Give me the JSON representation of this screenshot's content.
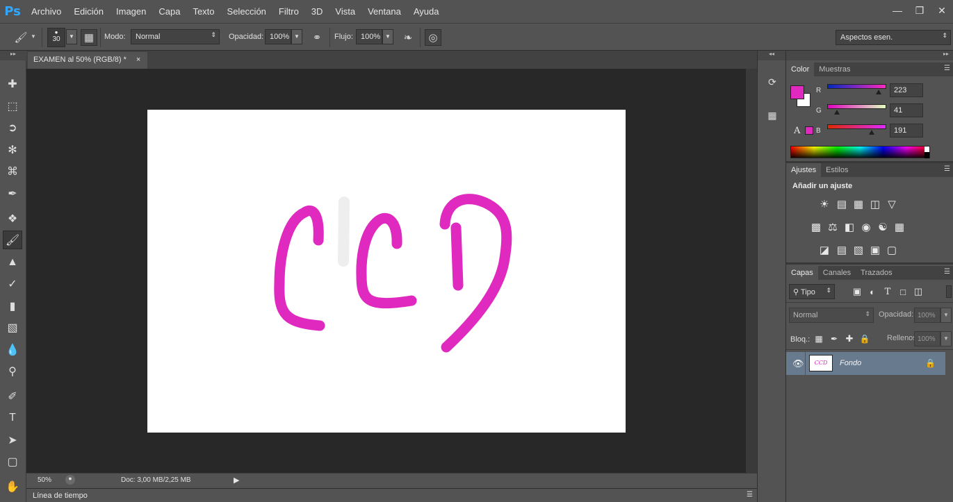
{
  "app": {
    "logo": "Ps"
  },
  "menu": [
    "Archivo",
    "Edición",
    "Imagen",
    "Capa",
    "Texto",
    "Selección",
    "Filtro",
    "3D",
    "Vista",
    "Ventana",
    "Ayuda"
  ],
  "window_controls": [
    "minimize-icon",
    "restore-icon",
    "close-icon"
  ],
  "options": {
    "brush_size": "30",
    "mode_label": "Modo:",
    "mode_value": "Normal",
    "opacity_label": "Opacidad:",
    "opacity_value": "100%",
    "flow_label": "Flujo:",
    "flow_value": "100%",
    "workspace": "Aspectos esen."
  },
  "document": {
    "tab_title": "EXAMEN al 50% (RGB/8) *",
    "tab_close": "×",
    "canvas_text": "CCD",
    "brush_color": "#df29bf"
  },
  "status": {
    "zoom": "50%",
    "doc_info": "Doc: 3,00 MB/2,25 MB"
  },
  "timeline": {
    "label": "Línea de tiempo"
  },
  "color_panel": {
    "tabs": [
      "Color",
      "Muestras"
    ],
    "foreground": "#df29bf",
    "background": "#ffffff",
    "channels": [
      {
        "label": "R",
        "value": "223",
        "fraction": 0.875
      },
      {
        "label": "G",
        "value": "41",
        "fraction": 0.16
      },
      {
        "label": "B",
        "value": "191",
        "fraction": 0.75
      }
    ]
  },
  "adjustments_panel": {
    "tabs": [
      "Ajustes",
      "Estilos"
    ],
    "heading": "Añadir un ajuste",
    "icons_row1": [
      "brightness-contrast-icon",
      "levels-icon",
      "curves-icon",
      "exposure-icon",
      "vibrance-icon"
    ],
    "icons_row2": [
      "hue-saturation-icon",
      "color-balance-icon",
      "black-white-icon",
      "photo-filter-icon",
      "channel-mixer-icon",
      "color-lookup-icon"
    ],
    "icons_row3": [
      "invert-icon",
      "posterize-icon",
      "threshold-icon",
      "selective-color-icon",
      "gradient-map-icon"
    ]
  },
  "layers_panel": {
    "tabs": [
      "Capas",
      "Canales",
      "Trazados"
    ],
    "filter_label": "Tipo",
    "blend_mode": "Normal",
    "opacity_label": "Opacidad:",
    "opacity_value": "100%",
    "lock_label": "Bloq.:",
    "fill_label": "Rellenos:",
    "fill_value": "100%",
    "layers": [
      {
        "name": "Fondo",
        "thumb_text": "CCD",
        "visible": true,
        "locked": true
      }
    ]
  }
}
